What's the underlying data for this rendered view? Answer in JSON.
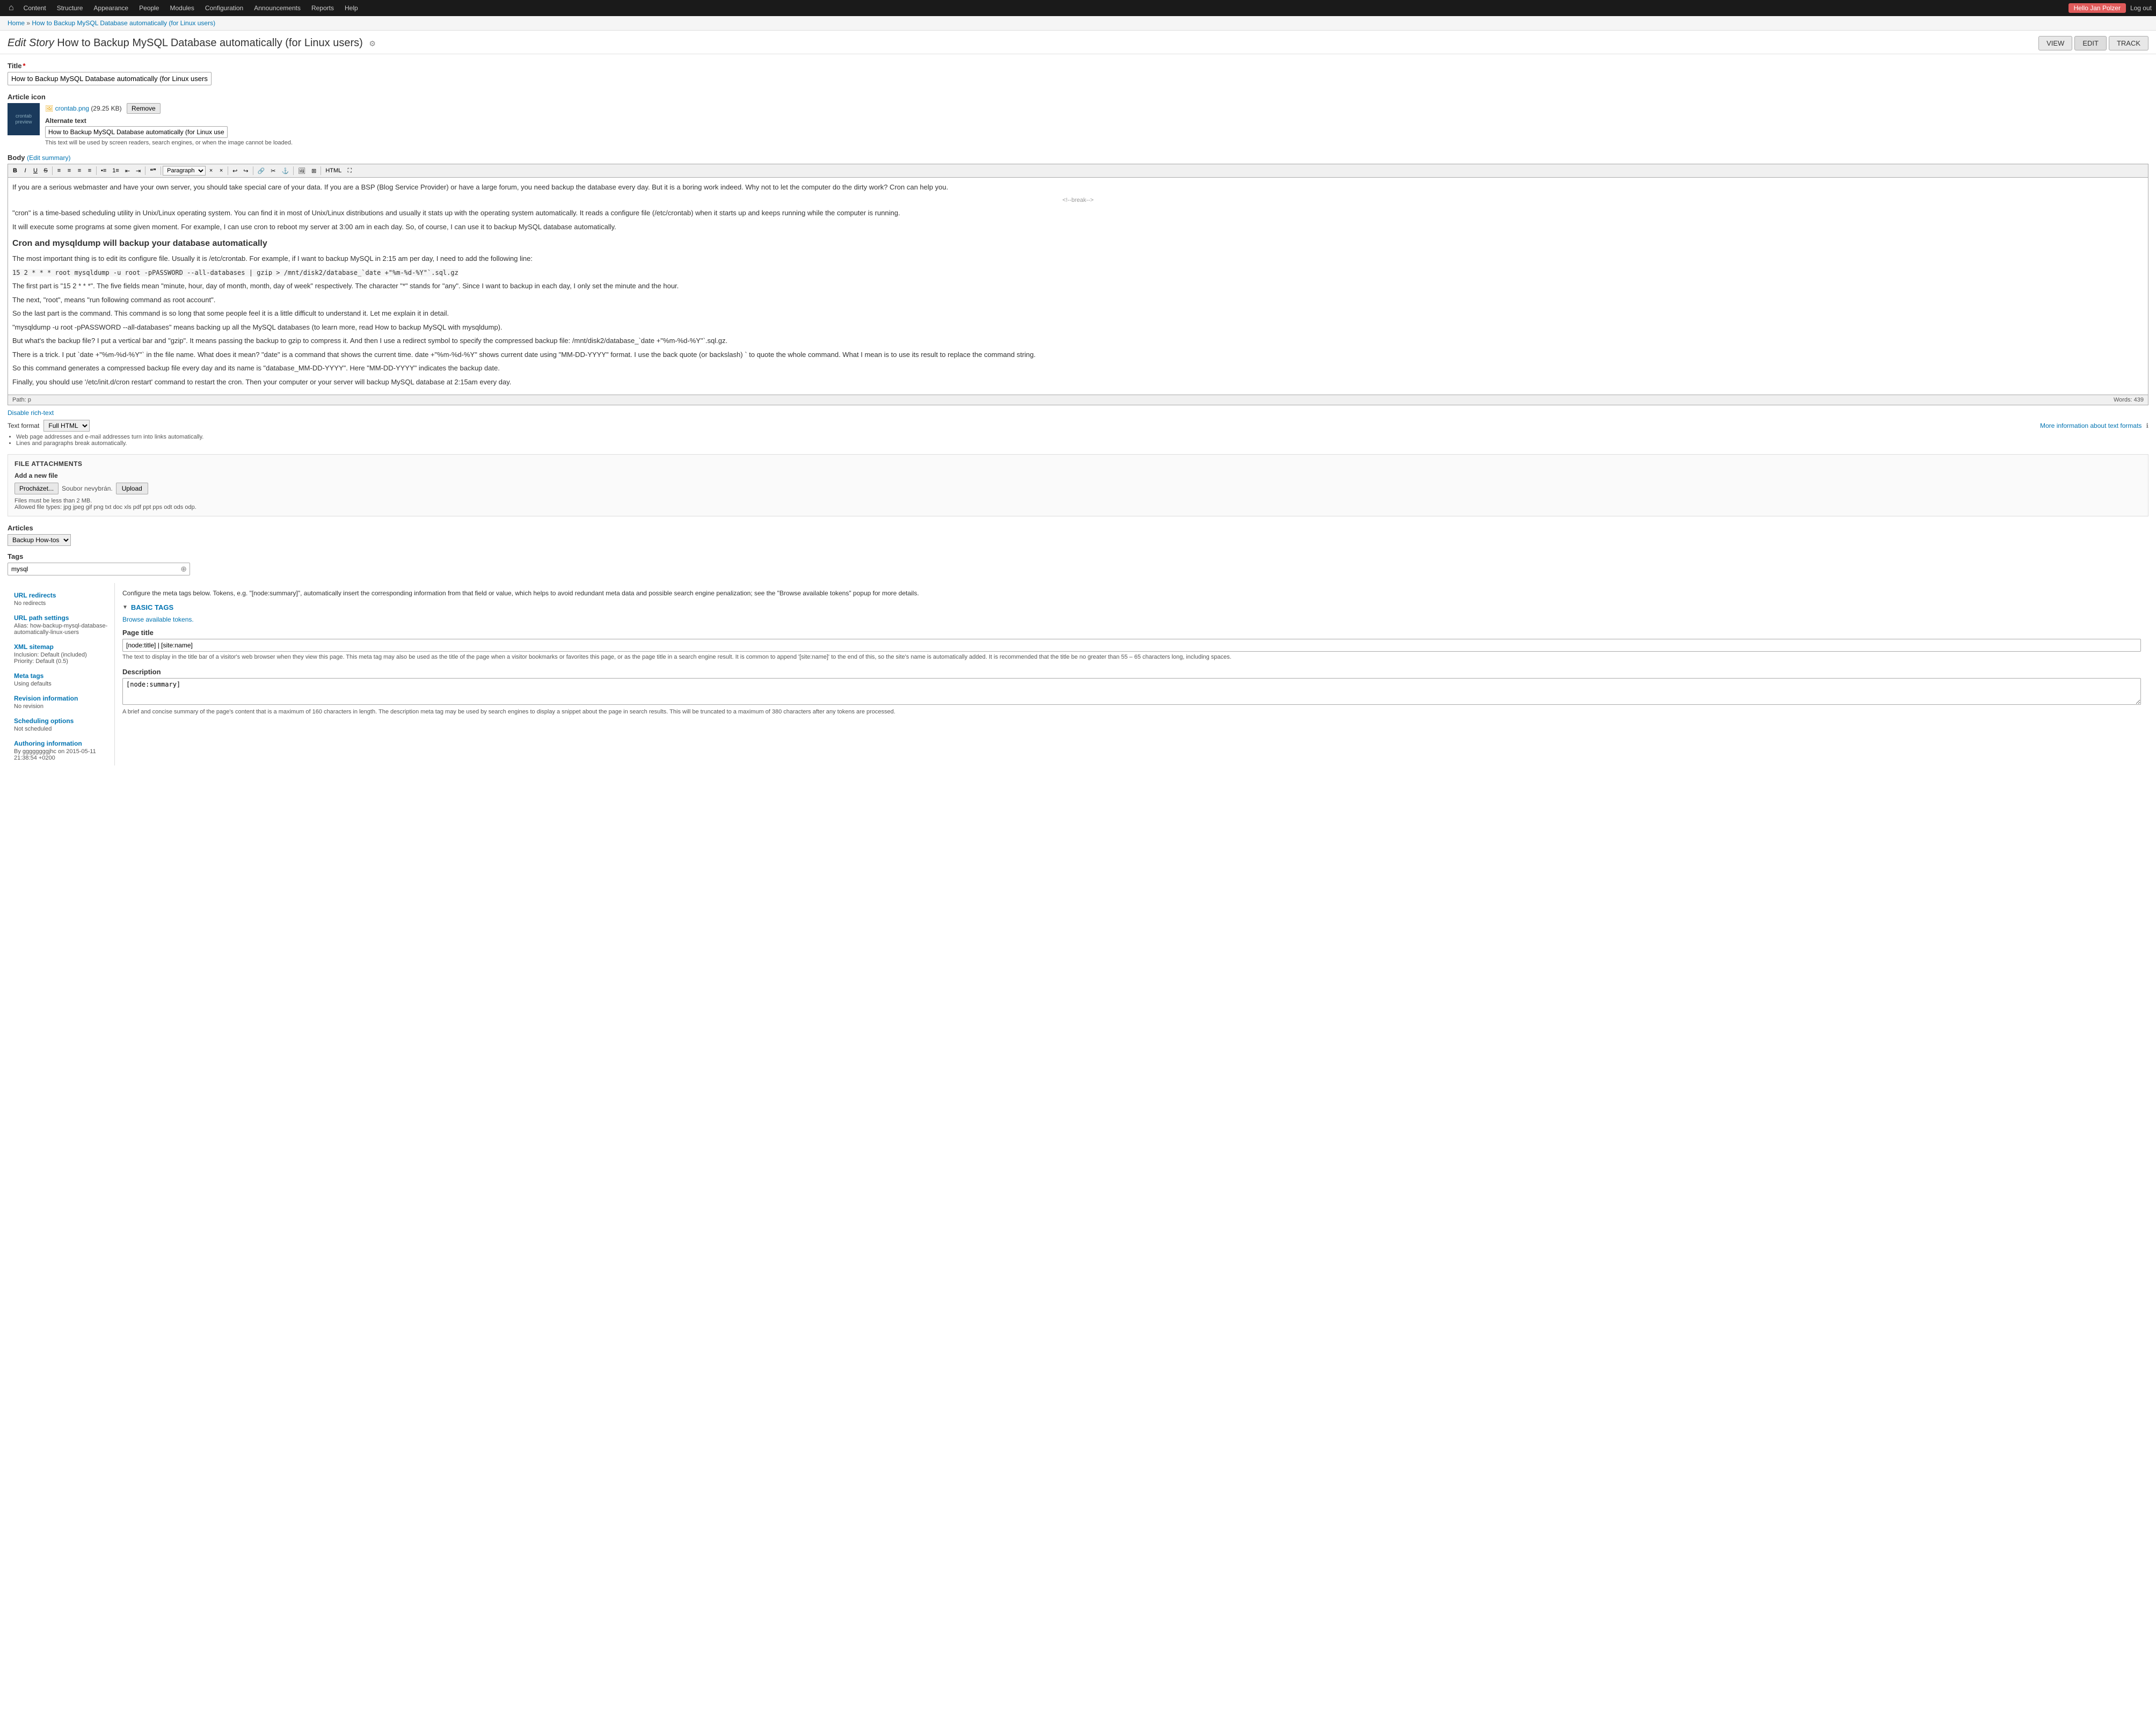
{
  "nav": {
    "home_icon": "⌂",
    "items": [
      {
        "id": "content",
        "label": "Content"
      },
      {
        "id": "structure",
        "label": "Structure"
      },
      {
        "id": "appearance",
        "label": "Appearance"
      },
      {
        "id": "people",
        "label": "People"
      },
      {
        "id": "modules",
        "label": "Modules"
      },
      {
        "id": "configuration",
        "label": "Configuration"
      },
      {
        "id": "announcements",
        "label": "Announcements"
      },
      {
        "id": "reports",
        "label": "Reports"
      },
      {
        "id": "help",
        "label": "Help"
      }
    ],
    "user_badge": "Hello Jan Polzer",
    "logout_label": "Log out"
  },
  "breadcrumb": {
    "home_label": "Home",
    "separator": "»",
    "page_label": "How to Backup MySQL Database automatically (for Linux users)"
  },
  "page_header": {
    "prefix": "Edit Story",
    "title": "How to Backup MySQL Database automatically (for Linux users)",
    "config_icon": "⚙",
    "btn_view": "VIEW",
    "btn_edit": "EDIT",
    "btn_track": "TRACK"
  },
  "title_field": {
    "label": "Title",
    "required": true,
    "value": "How to Backup MySQL Database automatically (for Linux users)"
  },
  "article_icon": {
    "label": "Article icon",
    "filename": "crontab.png",
    "filesize": "(29.25 KB)",
    "remove_label": "Remove",
    "alt_label": "Alternate text",
    "alt_value": "How to Backup MySQL Database automatically (for Linux users)",
    "alt_hint": "This text will be used by screen readers, search engines, or when the image cannot be loaded."
  },
  "body": {
    "label": "Body",
    "edit_summary_label": "(Edit summary)",
    "toolbar": {
      "buttons": [
        "B",
        "I",
        "U",
        "S",
        "",
        "",
        "",
        "",
        "",
        "P",
        "",
        "",
        "",
        "",
        "",
        "•",
        "",
        "",
        "",
        "",
        "",
        "",
        "",
        "",
        "Paragraph",
        "×",
        "×",
        "",
        "",
        "",
        "",
        "",
        "",
        "",
        "",
        "",
        "",
        "",
        "",
        "",
        "",
        "",
        "",
        "",
        "",
        "",
        "",
        "",
        "",
        "",
        "",
        "",
        "",
        "",
        "",
        "",
        "",
        "",
        "",
        ""
      ]
    },
    "content": {
      "para1": "If you are a serious webmaster and have your own server, you should take special care of your data. If you are a BSP (Blog Service Provider) or have a large forum, you need backup the database every day. But it is a boring work indeed. Why not to let the computer do the dirty work? Cron can help you.",
      "read_more": "<!--break-->",
      "para2": "\"cron\" is a time-based scheduling utility in Unix/Linux operating system. You can find it in most of Unix/Linux distributions and usually it stats up with the operating system automatically. It reads a configure file (/etc/crontab) when it starts up and keeps running while the computer is running.",
      "para3": "It will execute some programs at some given moment. For example, I can use cron to reboot my server at 3:00 am in each day. So, of course, I can use it to backup MySQL database automatically.",
      "heading": "Cron and mysqldump will backup your database automatically",
      "para4": "The most important thing is to edit its configure file. Usually it is /etc/crontab. For example, if I want to backup MySQL in 2:15 am per day, I need to add the following line:",
      "code1": "15 2 * * * root mysqldump -u root -pPASSWORD --all-databases | gzip > /mnt/disk2/database_`date +\"%m-%d-%Y\"`.sql.gz",
      "para5": "The first part is \"15 2 * * *\". The five fields mean \"minute, hour, day of month, month, day of week\" respectively. The character \"*\" stands for \"any\". Since I want to backup in each day, I only set the minute and the hour.",
      "para6": "The next, \"root\", means \"run following command as root account\".",
      "para7": "So the last part is the command. This command is so long that some people feel it is a little difficult to understand it. Let me explain it in detail.",
      "para8": "\"mysqldump -u root -pPASSWORD --all-databases\" means backing up all the MySQL databases (to learn more, read How to backup MySQL with mysqldump).",
      "para9": "But what's the backup file? I put a vertical bar and \"gzip\". It means passing the backup to gzip to compress it. And then I use a redirect symbol to specify the compressed backup file: /mnt/disk2/database_`date +\"%m-%d-%Y\"`.sql.gz.",
      "para10": "There is a trick. I put `date +\"%m-%d-%Y\"` in the file name. What does it mean? \"date\" is a command that shows the current time. date +\"%m-%d-%Y\" shows current date using \"MM-DD-YYYY\" format. I use the back quote (or backslash) ` to quote the whole command. What I mean is to use its result to replace the command string.",
      "para11": "So this command generates a compressed backup file every day and its name is \"database_MM-DD-YYYY\". Here \"MM-DD-YYYY\" indicates the backup date.",
      "para12": "Finally, you should use '/etc/init.d/cron restart' command to restart the cron. Then your computer or your server will backup MySQL database at 2:15am every day."
    },
    "footer_path": "Path: p",
    "footer_words": "Words: 439",
    "disable_richtext": "Disable rich-text",
    "text_format_label": "Text format",
    "text_format_value": "Full HTML",
    "more_info": "More information about text formats",
    "hints": [
      "Web page addresses and e-mail addresses turn into links automatically.",
      "Lines and paragraphs break automatically."
    ]
  },
  "file_attachments": {
    "section_title": "FILE ATTACHMENTS",
    "add_label": "Add a new file",
    "browse_btn": "Procházet...",
    "file_placeholder": "Soubor nevybrán.",
    "upload_btn": "Upload",
    "size_hint": "Files must be less than 2 MB.",
    "type_hint": "Allowed file types: jpg jpeg gif png txt doc xls pdf ppt pps odt ods odp."
  },
  "articles": {
    "label": "Articles",
    "value": "Backup How-tos",
    "options": [
      "Backup How-tos"
    ]
  },
  "tags": {
    "label": "Tags",
    "value": "mysql",
    "search_icon": "⊕"
  },
  "sidebar": {
    "sections": [
      {
        "id": "url-redirects",
        "link": "URL redirects",
        "value": "No redirects"
      },
      {
        "id": "url-path-settings",
        "link": "URL path settings",
        "value": "Alias: how-backup-mysql-database-automatically-linux-users"
      },
      {
        "id": "xml-sitemap",
        "link": "XML sitemap",
        "value": "Inclusion: Default (included)\nPriority: Default (0.5)"
      },
      {
        "id": "meta-tags",
        "link": "Meta tags",
        "value": "Using defaults"
      },
      {
        "id": "revision-information",
        "link": "Revision information",
        "value": "No revision"
      },
      {
        "id": "scheduling-options",
        "link": "Scheduling options",
        "value": "Not scheduled"
      },
      {
        "id": "authoring-information",
        "link": "Authoring information",
        "value": "By ggggggggjhc on 2015-05-11\n21:38:54 +0200"
      }
    ]
  },
  "meta_panel": {
    "intro": "Configure the meta tags below. Tokens, e.g. \"[node:summary]\", automatically insert the corresponding information from that field or value, which helps to avoid redundant meta data and possible search engine penalization; see the \"Browse available tokens\" popup for more details.",
    "basic_tags_label": "BASIC TAGS",
    "browse_tokens": "Browse available tokens.",
    "page_title": {
      "label": "Page title",
      "value": "[node:title] | [site:name]",
      "hint": "The text to display in the title bar of a visitor's web browser when they view this page. This meta tag may also be used as the title of the page when a visitor bookmarks or favorites this page, or as the page title in a search engine result. It is common to append '[site:name]' to the end of this, so the site's name is automatically added. It is recommended that the title be no greater than 55 – 65 characters long, including spaces."
    },
    "description": {
      "label": "Description",
      "value": "[node:summary]",
      "hint": "A brief and concise summary of the page's content that is a maximum of 160 characters in length. The description meta tag may be used by search engines to display a snippet about the page in search results. This will be truncated to a maximum of 380 characters after any tokens are processed."
    }
  }
}
